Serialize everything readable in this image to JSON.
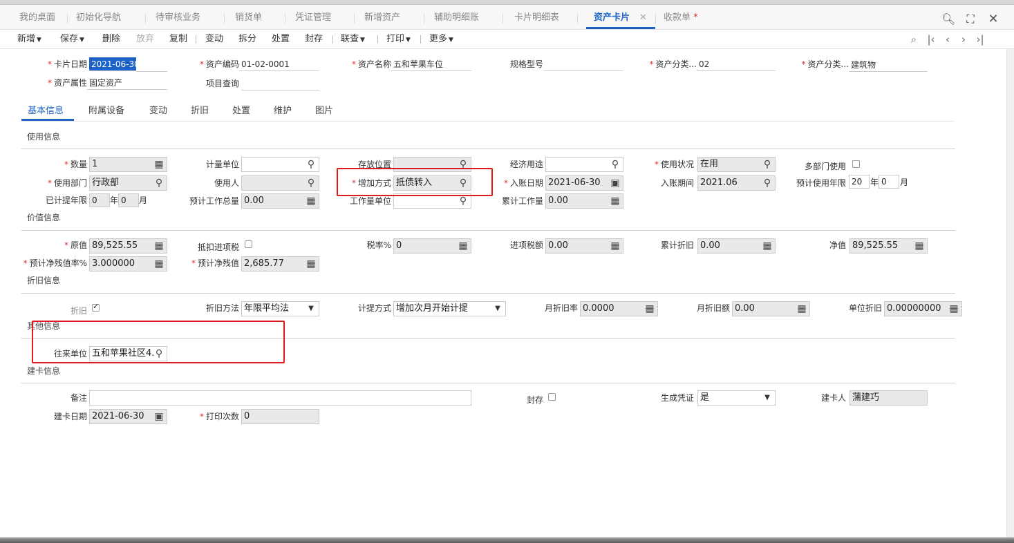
{
  "tabs": [
    {
      "label": "我的桌面"
    },
    {
      "label": "初始化导航"
    },
    {
      "label": "待审核业务"
    },
    {
      "label": "销货单"
    },
    {
      "label": "凭证管理"
    },
    {
      "label": "新增资产"
    },
    {
      "label": "辅助明细账"
    },
    {
      "label": "卡片明细表"
    },
    {
      "label": "资产卡片"
    },
    {
      "label": "收款单"
    }
  ],
  "tab_close": "✕",
  "tab_modified": "*",
  "toolbar": {
    "add": "新增",
    "save": "保存",
    "delete": "删除",
    "discard": "放弃",
    "copy": "复制",
    "change": "变动",
    "split": "拆分",
    "dispose": "处置",
    "seal": "封存",
    "linked_query": "联查",
    "print": "打印",
    "more": "更多"
  },
  "header": {
    "card_date_label": "卡片日期",
    "card_date": "2021-06-30",
    "asset_code_label": "资产编码",
    "asset_code": "01-02-0001",
    "asset_name_label": "资产名称",
    "asset_name": "五和苹果车位",
    "spec_label": "规格型号",
    "spec": "",
    "asset_cat_label": "资产分类...",
    "asset_cat": "02",
    "asset_cat2_label": "资产分类...",
    "asset_cat2": "建筑物",
    "asset_attr_label": "资产属性",
    "asset_attr": "固定资产",
    "project_label": "项目查询",
    "project": ""
  },
  "subtabs": [
    "基本信息",
    "附属设备",
    "变动",
    "折旧",
    "处置",
    "维护",
    "图片"
  ],
  "sections": {
    "usage": "使用信息",
    "value": "价值信息",
    "depreciation": "折旧信息",
    "other": "其他信息",
    "card": "建卡信息"
  },
  "usage": {
    "qty_label": "数量",
    "qty": "1",
    "unit_label": "计量单位",
    "unit": "",
    "location_label": "存放位置",
    "location": "",
    "purpose_label": "经济用途",
    "purpose": "",
    "status_label": "使用状况",
    "status": "在用",
    "multi_dept_label": "多部门使用",
    "dept_label": "使用部门",
    "dept": "行政部",
    "user_label": "使用人",
    "user": "",
    "add_method_label": "增加方式",
    "add_method": "抵债转入",
    "entry_date_label": "入账日期",
    "entry_date": "2021-06-30",
    "entry_period_label": "入账期间",
    "entry_period": "2021.06",
    "expected_years_label": "预计使用年限",
    "expected_years": "20",
    "year_unit": "年",
    "expected_months": "0",
    "month_unit": "月",
    "accrued_years_label": "已计提年限",
    "accrued_years": "0",
    "accrued_months": "0",
    "total_work_label": "预计工作总量",
    "total_work": "0.00",
    "work_unit_label": "工作量单位",
    "work_unit": "",
    "cum_work_label": "累计工作量",
    "cum_work": "0.00"
  },
  "value": {
    "orig_label": "原值",
    "orig": "89,525.55",
    "deduct_tax_label": "抵扣进项税",
    "tax_rate_label": "税率%",
    "tax_rate": "0",
    "input_tax_label": "进项税额",
    "input_tax": "0.00",
    "cum_dep_label": "累计折旧",
    "cum_dep": "0.00",
    "net_label": "净值",
    "net": "89,525.55",
    "residual_rate_label": "预计净残值率%",
    "residual_rate": "3.000000",
    "residual_label": "预计净残值",
    "residual": "2,685.77"
  },
  "dep": {
    "dep_label": "折旧",
    "method_label": "折旧方法",
    "method": "年限平均法",
    "accrual_label": "计提方式",
    "accrual": "增加次月开始计提",
    "month_rate_label": "月折旧率",
    "month_rate": "0.0000",
    "month_amount_label": "月折旧额",
    "month_amount": "0.00",
    "unit_dep_label": "单位折旧",
    "unit_dep": "0.00000000"
  },
  "other": {
    "partner_label": "往来单位",
    "partner": "五和苹果社区4..."
  },
  "card": {
    "remark_label": "备注",
    "remark": "",
    "seal_label": "封存",
    "voucher_label": "生成凭证",
    "voucher": "是",
    "creator_label": "建卡人",
    "creator": "蒲建巧",
    "card_date_label": "建卡日期",
    "card_date": "2021-06-30",
    "print_count_label": "打印次数",
    "print_count": "0"
  }
}
